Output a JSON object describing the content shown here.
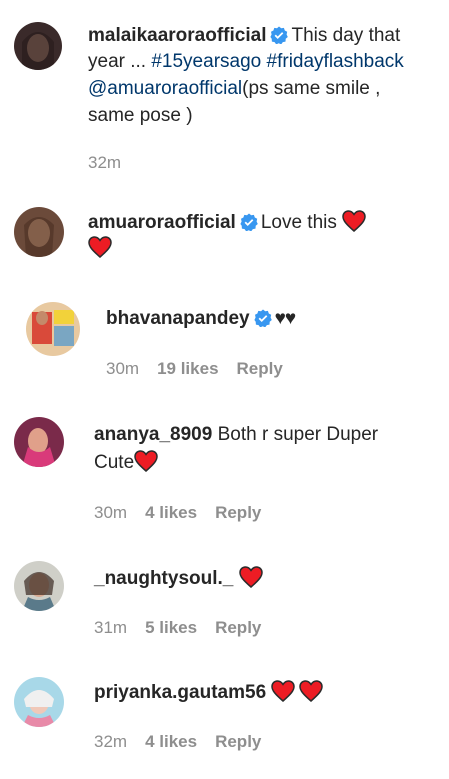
{
  "caption": {
    "username": "malaikaaroraofficial",
    "text_1": "This day that",
    "line2_text": "year ...",
    "hashtag_1": "#15yearsago",
    "hashtag_2": "#fridayflashback",
    "mention": "@amuaroraofficial",
    "text_3": "(ps same smile ,",
    "text_4": "same pose )",
    "time": "32m"
  },
  "comments": [
    {
      "username": "amuaroraofficial",
      "text": "Love this",
      "verified": true
    },
    {
      "username": "bhavanapandey",
      "text": "♥♥",
      "time": "30m",
      "likes": "19 likes",
      "reply": "Reply",
      "verified": true
    },
    {
      "username": "ananya_8909",
      "text_1": "Both r super Duper",
      "text_2": "Cute",
      "time": "30m",
      "likes": "4 likes",
      "reply": "Reply"
    },
    {
      "username": "_naughtysoul._",
      "time": "31m",
      "likes": "5 likes",
      "reply": "Reply"
    },
    {
      "username": "priyanka.gautam56",
      "time": "32m",
      "likes": "4 likes",
      "reply": "Reply"
    }
  ],
  "colors": {
    "heart": "#ed1c24",
    "verified": "#3897f0",
    "hashtag": "#00376b",
    "meta": "#8e8e8e"
  }
}
